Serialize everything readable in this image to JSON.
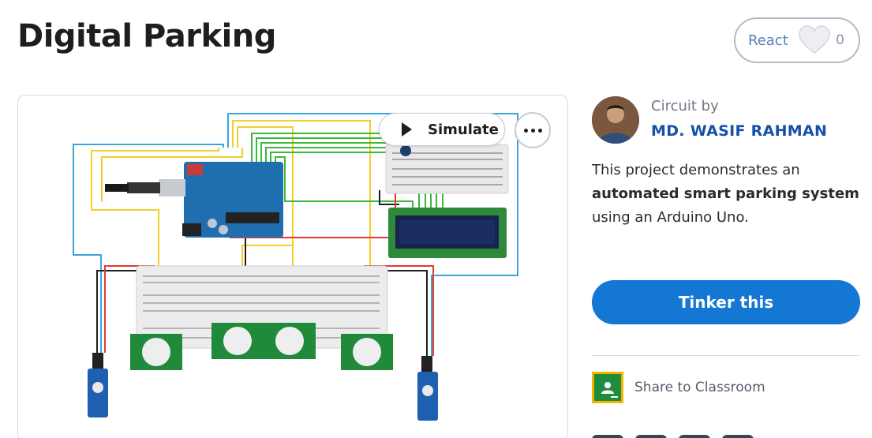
{
  "page": {
    "title": "Digital Parking"
  },
  "react": {
    "label": "React",
    "count": "0"
  },
  "canvas": {
    "simulate_label": "Simulate"
  },
  "author": {
    "circuit_by": "Circuit by",
    "name": "MD. WASIF RAHMAN"
  },
  "description": {
    "intro": "This project demonstrates an",
    "highlight": "automated smart parking system",
    "outro": "using an Arduino Uno."
  },
  "actions": {
    "tinker_label": "Tinker this",
    "share_label": "Share to Classroom"
  },
  "colors": {
    "accent": "#1477d4",
    "author_link": "#1550a8",
    "classroom_green": "#1e8e3e",
    "classroom_yellow": "#f4b400"
  },
  "icons": [
    "play-icon",
    "more-icon",
    "heart-icon",
    "google-classroom-icon"
  ]
}
